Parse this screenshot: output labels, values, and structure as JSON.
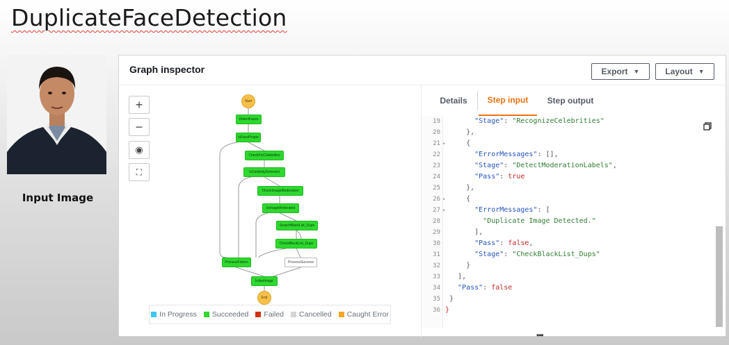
{
  "slide_title": "DuplicateFaceDetection",
  "photo_caption": "Input Image",
  "panel": {
    "title": "Graph inspector",
    "export_label": "Export",
    "layout_label": "Layout"
  },
  "zoom_controls": [
    "+",
    "−",
    "◉",
    "⛶"
  ],
  "graph": {
    "nodes": {
      "start": "Start",
      "detect_faces": "DetectFaces",
      "is_face_proper": "IsFaceProper",
      "check_celebrities": "CheckForCelebrities",
      "is_celebrity_detected": "IsCelebrityDetected",
      "check_moderation": "CheckImageModeration",
      "is_image_moderated": "IsImageModerated",
      "search_blacklist": "SearchBlackList_Dups",
      "check_blacklist": "CheckBlackList_Dups",
      "process_failure": "ProcessFailure",
      "process_success": "ProcessSuccess",
      "index_image": "IndexImage",
      "end": "End"
    }
  },
  "legend": [
    {
      "label": "In Progress",
      "color": "#3ec7f0"
    },
    {
      "label": "Succeeded",
      "color": "#2ed82e"
    },
    {
      "label": "Failed",
      "color": "#d13212"
    },
    {
      "label": "Cancelled",
      "color": "#d5d5d5"
    },
    {
      "label": "Caught Error",
      "color": "#f5a623"
    }
  ],
  "tabs": {
    "details": "Details",
    "step_input": "Step input",
    "step_output": "Step output"
  },
  "code": {
    "l19_num": "19",
    "l20_num": "20",
    "l21_num": "21",
    "l22_num": "22",
    "l23_num": "23",
    "l24_num": "24",
    "l25_num": "25",
    "l26_num": "26",
    "l27_num": "27",
    "l28_num": "28",
    "l29_num": "29",
    "l30_num": "30",
    "l31_num": "31",
    "l32_num": "32",
    "l33_num": "33",
    "l34_num": "34",
    "l35_num": "35",
    "l36_num": "36",
    "stage_key": "\"Stage\"",
    "error_key": "\"ErrorMessages\"",
    "pass_key": "\"Pass\"",
    "stage_recognize": "\"RecognizeCelebrities\"",
    "stage_moderation": "\"DetectModerationLabels\"",
    "stage_blacklist": "\"CheckBlackList_Dups\"",
    "dup_message": "\"Duplicate Image Detected.\"",
    "true_val": "true",
    "false_val": "false"
  }
}
